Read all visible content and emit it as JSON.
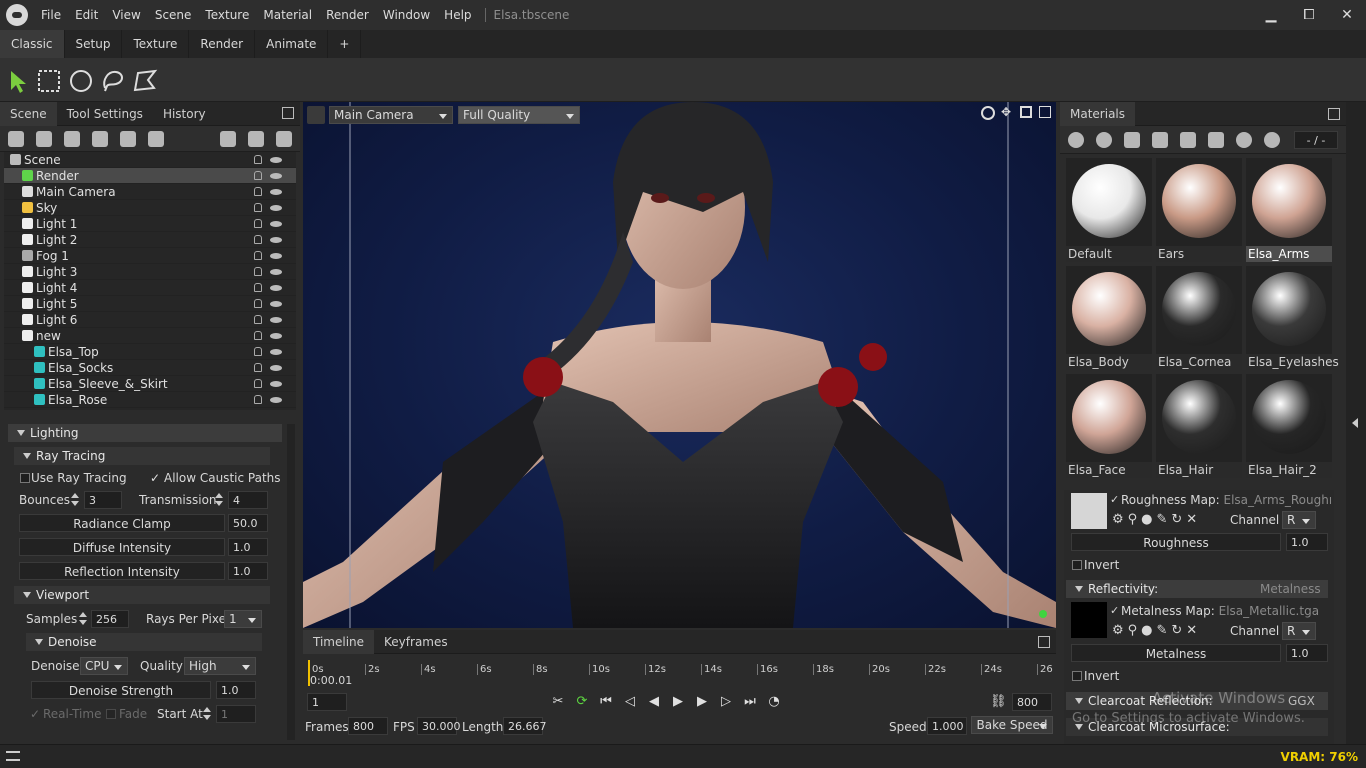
{
  "app": {
    "title": "Elsa.tbscene"
  },
  "menu": [
    "File",
    "Edit",
    "View",
    "Scene",
    "Texture",
    "Material",
    "Render",
    "Window",
    "Help"
  ],
  "window_controls": {
    "minimize": "▁",
    "maximize": "⧠",
    "close": "✕"
  },
  "workspace_tabs": [
    "Classic",
    "Setup",
    "Texture",
    "Render",
    "Animate",
    "+"
  ],
  "left_tabs": [
    "Scene",
    "Tool Settings",
    "History"
  ],
  "tree": [
    {
      "label": "Scene",
      "depth": 0
    },
    {
      "label": "Render",
      "depth": 1,
      "selected": true
    },
    {
      "label": "Main Camera",
      "depth": 1
    },
    {
      "label": "Sky",
      "depth": 1
    },
    {
      "label": "Light 1",
      "depth": 1
    },
    {
      "label": "Light 2",
      "depth": 1
    },
    {
      "label": "Fog 1",
      "depth": 1
    },
    {
      "label": "Light 3",
      "depth": 1
    },
    {
      "label": "Light 4",
      "depth": 1
    },
    {
      "label": "Light 5",
      "depth": 1
    },
    {
      "label": "Light 6",
      "depth": 1
    },
    {
      "label": "new",
      "depth": 1
    },
    {
      "label": "Elsa_Top",
      "depth": 2
    },
    {
      "label": "Elsa_Socks",
      "depth": 2
    },
    {
      "label": "Elsa_Sleeve_&_Skirt",
      "depth": 2
    },
    {
      "label": "Elsa_Rose",
      "depth": 2
    }
  ],
  "lighting": {
    "section": "Lighting",
    "ray_tracing": "Ray Tracing",
    "use_ray_tracing": "Use Ray Tracing",
    "allow_caustic": "Allow Caustic Paths",
    "bounces_label": "Bounces",
    "bounces": "3",
    "transmission_label": "Transmission",
    "transmission": "4",
    "radiance_clamp_label": "Radiance Clamp",
    "radiance_clamp": "50.0",
    "diffuse_label": "Diffuse Intensity",
    "diffuse": "1.0",
    "reflection_label": "Reflection Intensity",
    "reflection": "1.0",
    "viewport": "Viewport",
    "samples_label": "Samples",
    "samples": "256",
    "rpp_label": "Rays Per Pixel",
    "rpp": "1",
    "denoise_section": "Denoise",
    "denoise_label": "Denoise",
    "denoise": "CPU",
    "quality_label": "Quality",
    "quality": "High",
    "denoise_strength_label": "Denoise Strength",
    "denoise_strength": "1.0",
    "realtime": "Real-Time",
    "fade": "Fade",
    "start_at_label": "Start At",
    "start_at": "1"
  },
  "viewport": {
    "camera": "Main Camera",
    "quality": "Full Quality"
  },
  "timeline": {
    "tabs": [
      "Timeline",
      "Keyframes"
    ],
    "ticks": [
      "0s",
      "2s",
      "4s",
      "6s",
      "8s",
      "10s",
      "12s",
      "14s",
      "16s",
      "18s",
      "20s",
      "22s",
      "24s",
      "26"
    ],
    "current_time": "0:00.01",
    "frame": "1",
    "end_frame": "800",
    "frames_label": "Frames",
    "frames": "800",
    "fps_label": "FPS",
    "fps": "30.000",
    "length_label": "Length",
    "length": "26.667",
    "speed_label": "Speed",
    "speed": "1.000",
    "bake_speed": "Bake Speed"
  },
  "materials": {
    "tab": "Materials",
    "counter": "- / -",
    "items": [
      {
        "label": "Default",
        "color": "#e8e8e8"
      },
      {
        "label": "Ears",
        "color": "#c99a86"
      },
      {
        "label": "Elsa_Arms",
        "color": "#cfa393",
        "selected": true
      },
      {
        "label": "Elsa_Body",
        "color": "#d9b1a3"
      },
      {
        "label": "Elsa_Cornea",
        "color": "#2a2a2a"
      },
      {
        "label": "Elsa_Eyelashes",
        "color": "#3a3a3a"
      },
      {
        "label": "Elsa_Face",
        "color": "#d0a597"
      },
      {
        "label": "Elsa_Hair",
        "color": "#2e2e2e"
      },
      {
        "label": "Elsa_Hair_2",
        "color": "#262626"
      }
    ],
    "roughness_map_label": "Roughness Map:",
    "roughness_map": "Elsa_Arms_Roughness:",
    "channel_label": "Channel",
    "channel": "R",
    "roughness_label": "Roughness",
    "roughness": "1.0",
    "invert": "Invert",
    "reflectivity": "Reflectivity:",
    "reflectivity_mode": "Metalness",
    "metalness_map_label": "Metalness Map:",
    "metalness_map": "Elsa_Metallic.tga",
    "metalness_label": "Metalness",
    "metalness": "1.0",
    "clearcoat_reflection": "Clearcoat Reflection:",
    "clearcoat_mode": "GGX",
    "clearcoat_micro": "Clearcoat Microsurface:",
    "watermark_1": "Activate Windows",
    "watermark_2": "Go to Settings to activate Windows."
  },
  "status": {
    "vram": "VRAM: 76%"
  }
}
